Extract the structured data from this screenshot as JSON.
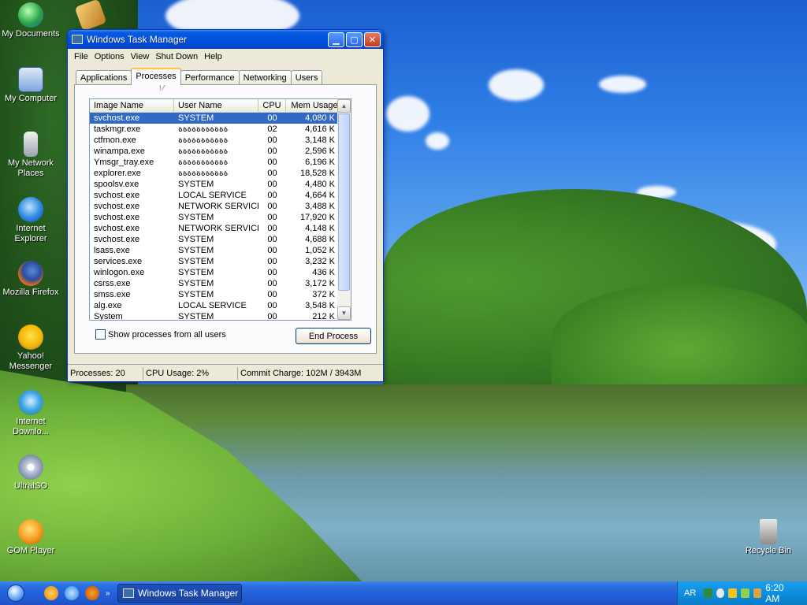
{
  "desktop": {
    "icons": [
      {
        "label": "My Documents",
        "icon": "my-documents-icon"
      },
      {
        "label": "My Computer",
        "icon": "my-computer-icon"
      },
      {
        "label": "My Network Places",
        "icon": "network-places-icon"
      },
      {
        "label": "Internet Explorer",
        "icon": "internet-explorer-icon"
      },
      {
        "label": "Mozilla Firefox",
        "icon": "firefox-icon"
      },
      {
        "label": "Yahoo! Messenger",
        "icon": "yahoo-messenger-icon"
      },
      {
        "label": "Internet Downlo...",
        "icon": "internet-download-icon"
      },
      {
        "label": "UltraISO",
        "icon": "ultraiso-icon"
      },
      {
        "label": "GOM Player",
        "icon": "gom-player-icon"
      },
      {
        "label": "Recycle Bin",
        "icon": "recycle-bin-icon"
      }
    ]
  },
  "window": {
    "title": "Windows Task Manager",
    "menu": [
      "File",
      "Options",
      "View",
      "Shut Down",
      "Help"
    ],
    "tabs": [
      "Applications",
      "Processes",
      "Performance",
      "Networking",
      "Users"
    ],
    "active_tab": "Processes",
    "columns": [
      "Image Name",
      "User Name",
      "CPU",
      "Mem Usage"
    ],
    "processes": [
      {
        "name": "svchost.exe",
        "user": "SYSTEM",
        "cpu": "00",
        "mem": "4,080 K",
        "selected": true
      },
      {
        "name": "taskmgr.exe",
        "user": "ةةةةةةةةةةة",
        "cpu": "02",
        "mem": "4,616 K"
      },
      {
        "name": "ctfmon.exe",
        "user": "ةةةةةةةةةةة",
        "cpu": "00",
        "mem": "3,148 K"
      },
      {
        "name": "winampa.exe",
        "user": "ةةةةةةةةةةة",
        "cpu": "00",
        "mem": "2,596 K"
      },
      {
        "name": "Ymsgr_tray.exe",
        "user": "ةةةةةةةةةةة",
        "cpu": "00",
        "mem": "6,196 K"
      },
      {
        "name": "explorer.exe",
        "user": "ةةةةةةةةةةة",
        "cpu": "00",
        "mem": "18,528 K"
      },
      {
        "name": "spoolsv.exe",
        "user": "SYSTEM",
        "cpu": "00",
        "mem": "4,480 K"
      },
      {
        "name": "svchost.exe",
        "user": "LOCAL SERVICE",
        "cpu": "00",
        "mem": "4,664 K"
      },
      {
        "name": "svchost.exe",
        "user": "NETWORK SERVICE",
        "cpu": "00",
        "mem": "3,488 K"
      },
      {
        "name": "svchost.exe",
        "user": "SYSTEM",
        "cpu": "00",
        "mem": "17,920 K"
      },
      {
        "name": "svchost.exe",
        "user": "NETWORK SERVICE",
        "cpu": "00",
        "mem": "4,148 K"
      },
      {
        "name": "svchost.exe",
        "user": "SYSTEM",
        "cpu": "00",
        "mem": "4,688 K"
      },
      {
        "name": "lsass.exe",
        "user": "SYSTEM",
        "cpu": "00",
        "mem": "1,052 K"
      },
      {
        "name": "services.exe",
        "user": "SYSTEM",
        "cpu": "00",
        "mem": "3,232 K"
      },
      {
        "name": "winlogon.exe",
        "user": "SYSTEM",
        "cpu": "00",
        "mem": "436 K"
      },
      {
        "name": "csrss.exe",
        "user": "SYSTEM",
        "cpu": "00",
        "mem": "3,172 K"
      },
      {
        "name": "smss.exe",
        "user": "SYSTEM",
        "cpu": "00",
        "mem": "372 K"
      },
      {
        "name": "alg.exe",
        "user": "LOCAL SERVICE",
        "cpu": "00",
        "mem": "3,548 K"
      },
      {
        "name": "System",
        "user": "SYSTEM",
        "cpu": "00",
        "mem": "212 K"
      }
    ],
    "show_all_label": "Show processes from all users",
    "end_process_label": "End Process",
    "status": {
      "processes": "Processes: 20",
      "cpu": "CPU Usage: 2%",
      "commit": "Commit Charge: 102M / 3943M"
    }
  },
  "taskbar": {
    "task_label": "Windows Task Manager",
    "tray_lang": "AR",
    "clock": "6:20 AM"
  },
  "colors": {
    "titlebar": "#0054e3",
    "selection": "#316ac5",
    "taskbar": "#245ed8",
    "tray": "#0d8ad9"
  }
}
